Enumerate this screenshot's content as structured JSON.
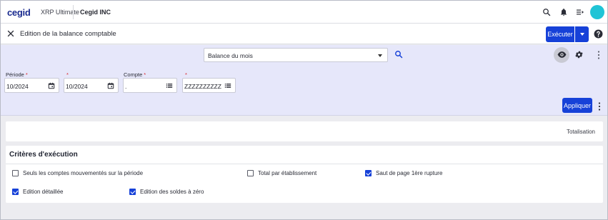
{
  "topbar": {
    "brand": "cegid",
    "product": "XRP Ultimate",
    "company": "Cegid INC",
    "icons": [
      "search-icon",
      "bell-icon",
      "menu-list-icon",
      "avatar"
    ]
  },
  "titlebar": {
    "title": "Edition de la balance comptable",
    "execute_label": "Exécuter"
  },
  "filters": {
    "report_select": "Balance du mois",
    "fields": [
      {
        "label": "Période",
        "required": "*",
        "value": "10/2024",
        "icon": "calendar-icon"
      },
      {
        "label": "",
        "required": "*",
        "value": "10/2024",
        "icon": "calendar-icon"
      },
      {
        "label": "Compte",
        "required": "*",
        "value": ".",
        "icon": "list-icon"
      },
      {
        "label": "",
        "required": "*",
        "value": "ZZZZZZZZZZ",
        "icon": "list-icon"
      }
    ],
    "apply_label": "Appliquer"
  },
  "totalisation": {
    "label": "Totalisation"
  },
  "criteria": {
    "title": "Critères d'exécution",
    "options": [
      {
        "label": "Seuls les comptes mouvementés sur la période",
        "checked": false
      },
      {
        "label": "Total par établissement",
        "checked": false
      },
      {
        "label": "Saut de page 1ère rupture",
        "checked": true
      },
      {
        "label": "Edition détaillée",
        "checked": true
      },
      {
        "label": "Edition des soldes à zéro",
        "checked": true
      }
    ]
  },
  "colors": {
    "accent": "#1641d8",
    "band": "#e6e7fa",
    "avatar": "#1fc4d6",
    "required": "#d9262c"
  }
}
